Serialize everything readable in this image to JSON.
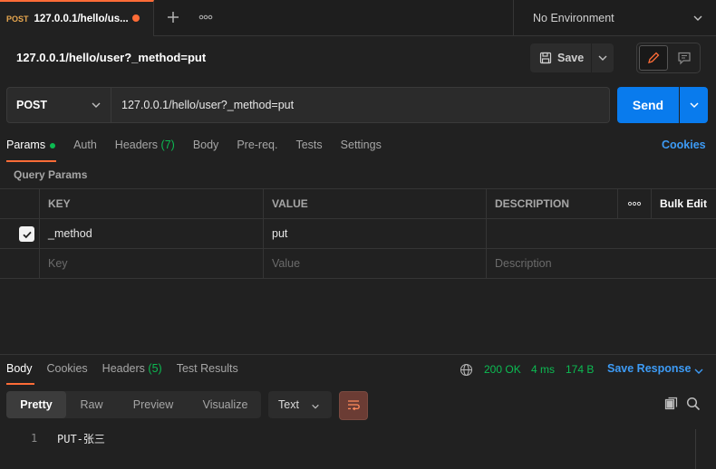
{
  "tab": {
    "method": "POST",
    "title": "127.0.0.1/hello/us..."
  },
  "environment": {
    "label": "No Environment"
  },
  "request": {
    "title": "127.0.0.1/hello/user?_method=put",
    "save_label": "Save",
    "method": "POST",
    "url": "127.0.0.1/hello/user?_method=put",
    "send_label": "Send"
  },
  "req_tabs": {
    "params": "Params",
    "auth": "Auth",
    "headers": "Headers",
    "headers_count": "(7)",
    "body": "Body",
    "prereq": "Pre-req.",
    "tests": "Tests",
    "settings": "Settings",
    "cookies": "Cookies"
  },
  "query_params": {
    "title": "Query Params",
    "columns": {
      "key": "KEY",
      "value": "VALUE",
      "description": "DESCRIPTION",
      "bulk_edit": "Bulk Edit"
    },
    "rows": [
      {
        "key": "_method",
        "value": "put",
        "description": "",
        "checked": true
      }
    ],
    "placeholders": {
      "key": "Key",
      "value": "Value",
      "description": "Description"
    }
  },
  "response": {
    "tabs": {
      "body": "Body",
      "cookies": "Cookies",
      "headers": "Headers",
      "headers_count": "(5)",
      "test_results": "Test Results"
    },
    "status": "200 OK",
    "time": "4 ms",
    "size": "174 B",
    "save_response": "Save Response",
    "views": [
      "Pretty",
      "Raw",
      "Preview",
      "Visualize"
    ],
    "format": "Text",
    "lines": [
      {
        "no": "1",
        "text": "PUT-张三"
      }
    ]
  },
  "colors": {
    "accent": "#ff6c37",
    "send": "#097bed",
    "success": "#0cbb52",
    "link": "#3d9bf5"
  }
}
